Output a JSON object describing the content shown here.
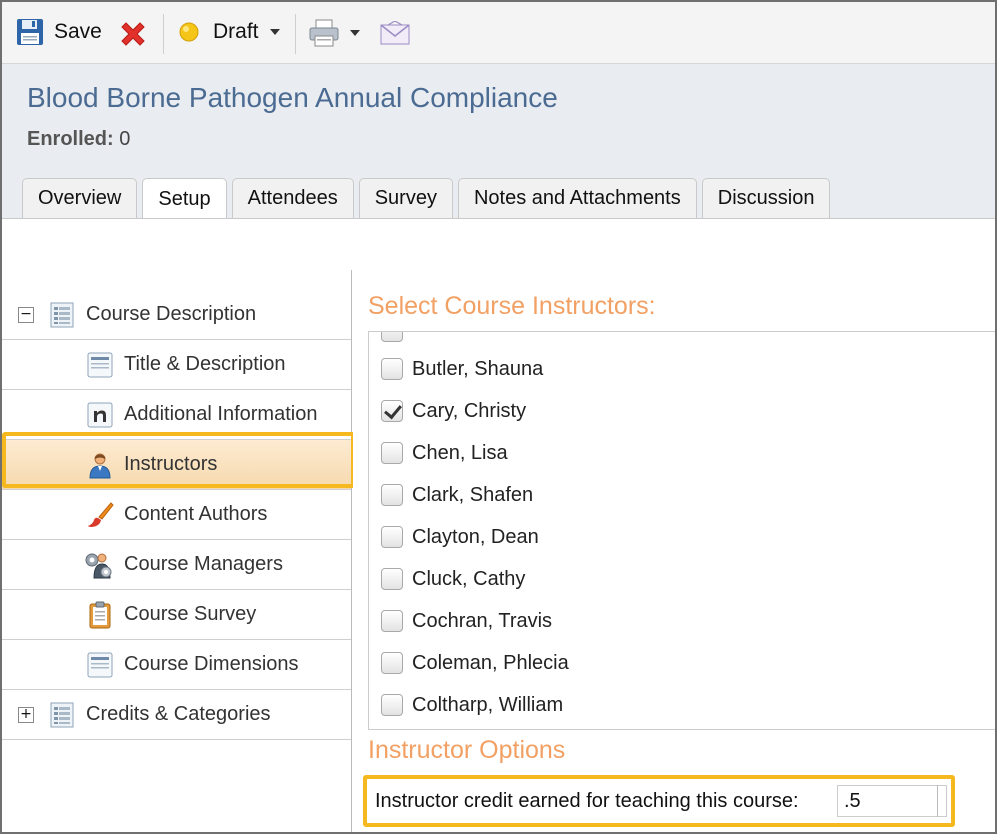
{
  "toolbar": {
    "save_label": "Save",
    "status_label": "Draft",
    "status_color": "#f5c518"
  },
  "header": {
    "title": "Blood Borne Pathogen Annual Compliance",
    "enrolled_label": "Enrolled:",
    "enrolled_count": "0"
  },
  "tabs": [
    {
      "label": "Overview"
    },
    {
      "label": "Setup",
      "active": true
    },
    {
      "label": "Attendees"
    },
    {
      "label": "Survey"
    },
    {
      "label": "Notes and Attachments"
    },
    {
      "label": "Discussion"
    }
  ],
  "sidebar": {
    "items": [
      {
        "label": "Course Description",
        "icon": "document-list-icon",
        "expander": "−"
      },
      {
        "label": "Title & Description",
        "icon": "page-icon"
      },
      {
        "label": "Additional Information",
        "icon": "info-n-icon"
      },
      {
        "label": "Instructors",
        "icon": "instructor-person-icon",
        "selected": true
      },
      {
        "label": "Content Authors",
        "icon": "paintbrush-icon"
      },
      {
        "label": "Course Managers",
        "icon": "managers-gear-icon"
      },
      {
        "label": "Course Survey",
        "icon": "clipboard-icon"
      },
      {
        "label": "Course Dimensions",
        "icon": "page-icon"
      },
      {
        "label": "Credits & Categories",
        "icon": "document-list-icon",
        "expander": "+"
      }
    ]
  },
  "main": {
    "select_title": "Select Course Instructors:",
    "instructors": [
      {
        "name": "Butler, Shauna",
        "checked": false
      },
      {
        "name": "Cary, Christy",
        "checked": true
      },
      {
        "name": "Chen, Lisa",
        "checked": false
      },
      {
        "name": "Clark, Shafen",
        "checked": false
      },
      {
        "name": "Clayton, Dean",
        "checked": false
      },
      {
        "name": "Cluck, Cathy",
        "checked": false
      },
      {
        "name": "Cochran, Travis",
        "checked": false
      },
      {
        "name": "Coleman, Phlecia",
        "checked": false
      },
      {
        "name": "Coltharp, William",
        "checked": false
      }
    ],
    "options_title": "Instructor Options",
    "credit_label": "Instructor credit earned for teaching this course:",
    "credit_value": ".5"
  },
  "colors": {
    "title_blue": "#4b6b92",
    "section_orange": "#f2a063",
    "highlight": "#f5b81e",
    "selected_bg": "#f8ddb4"
  }
}
